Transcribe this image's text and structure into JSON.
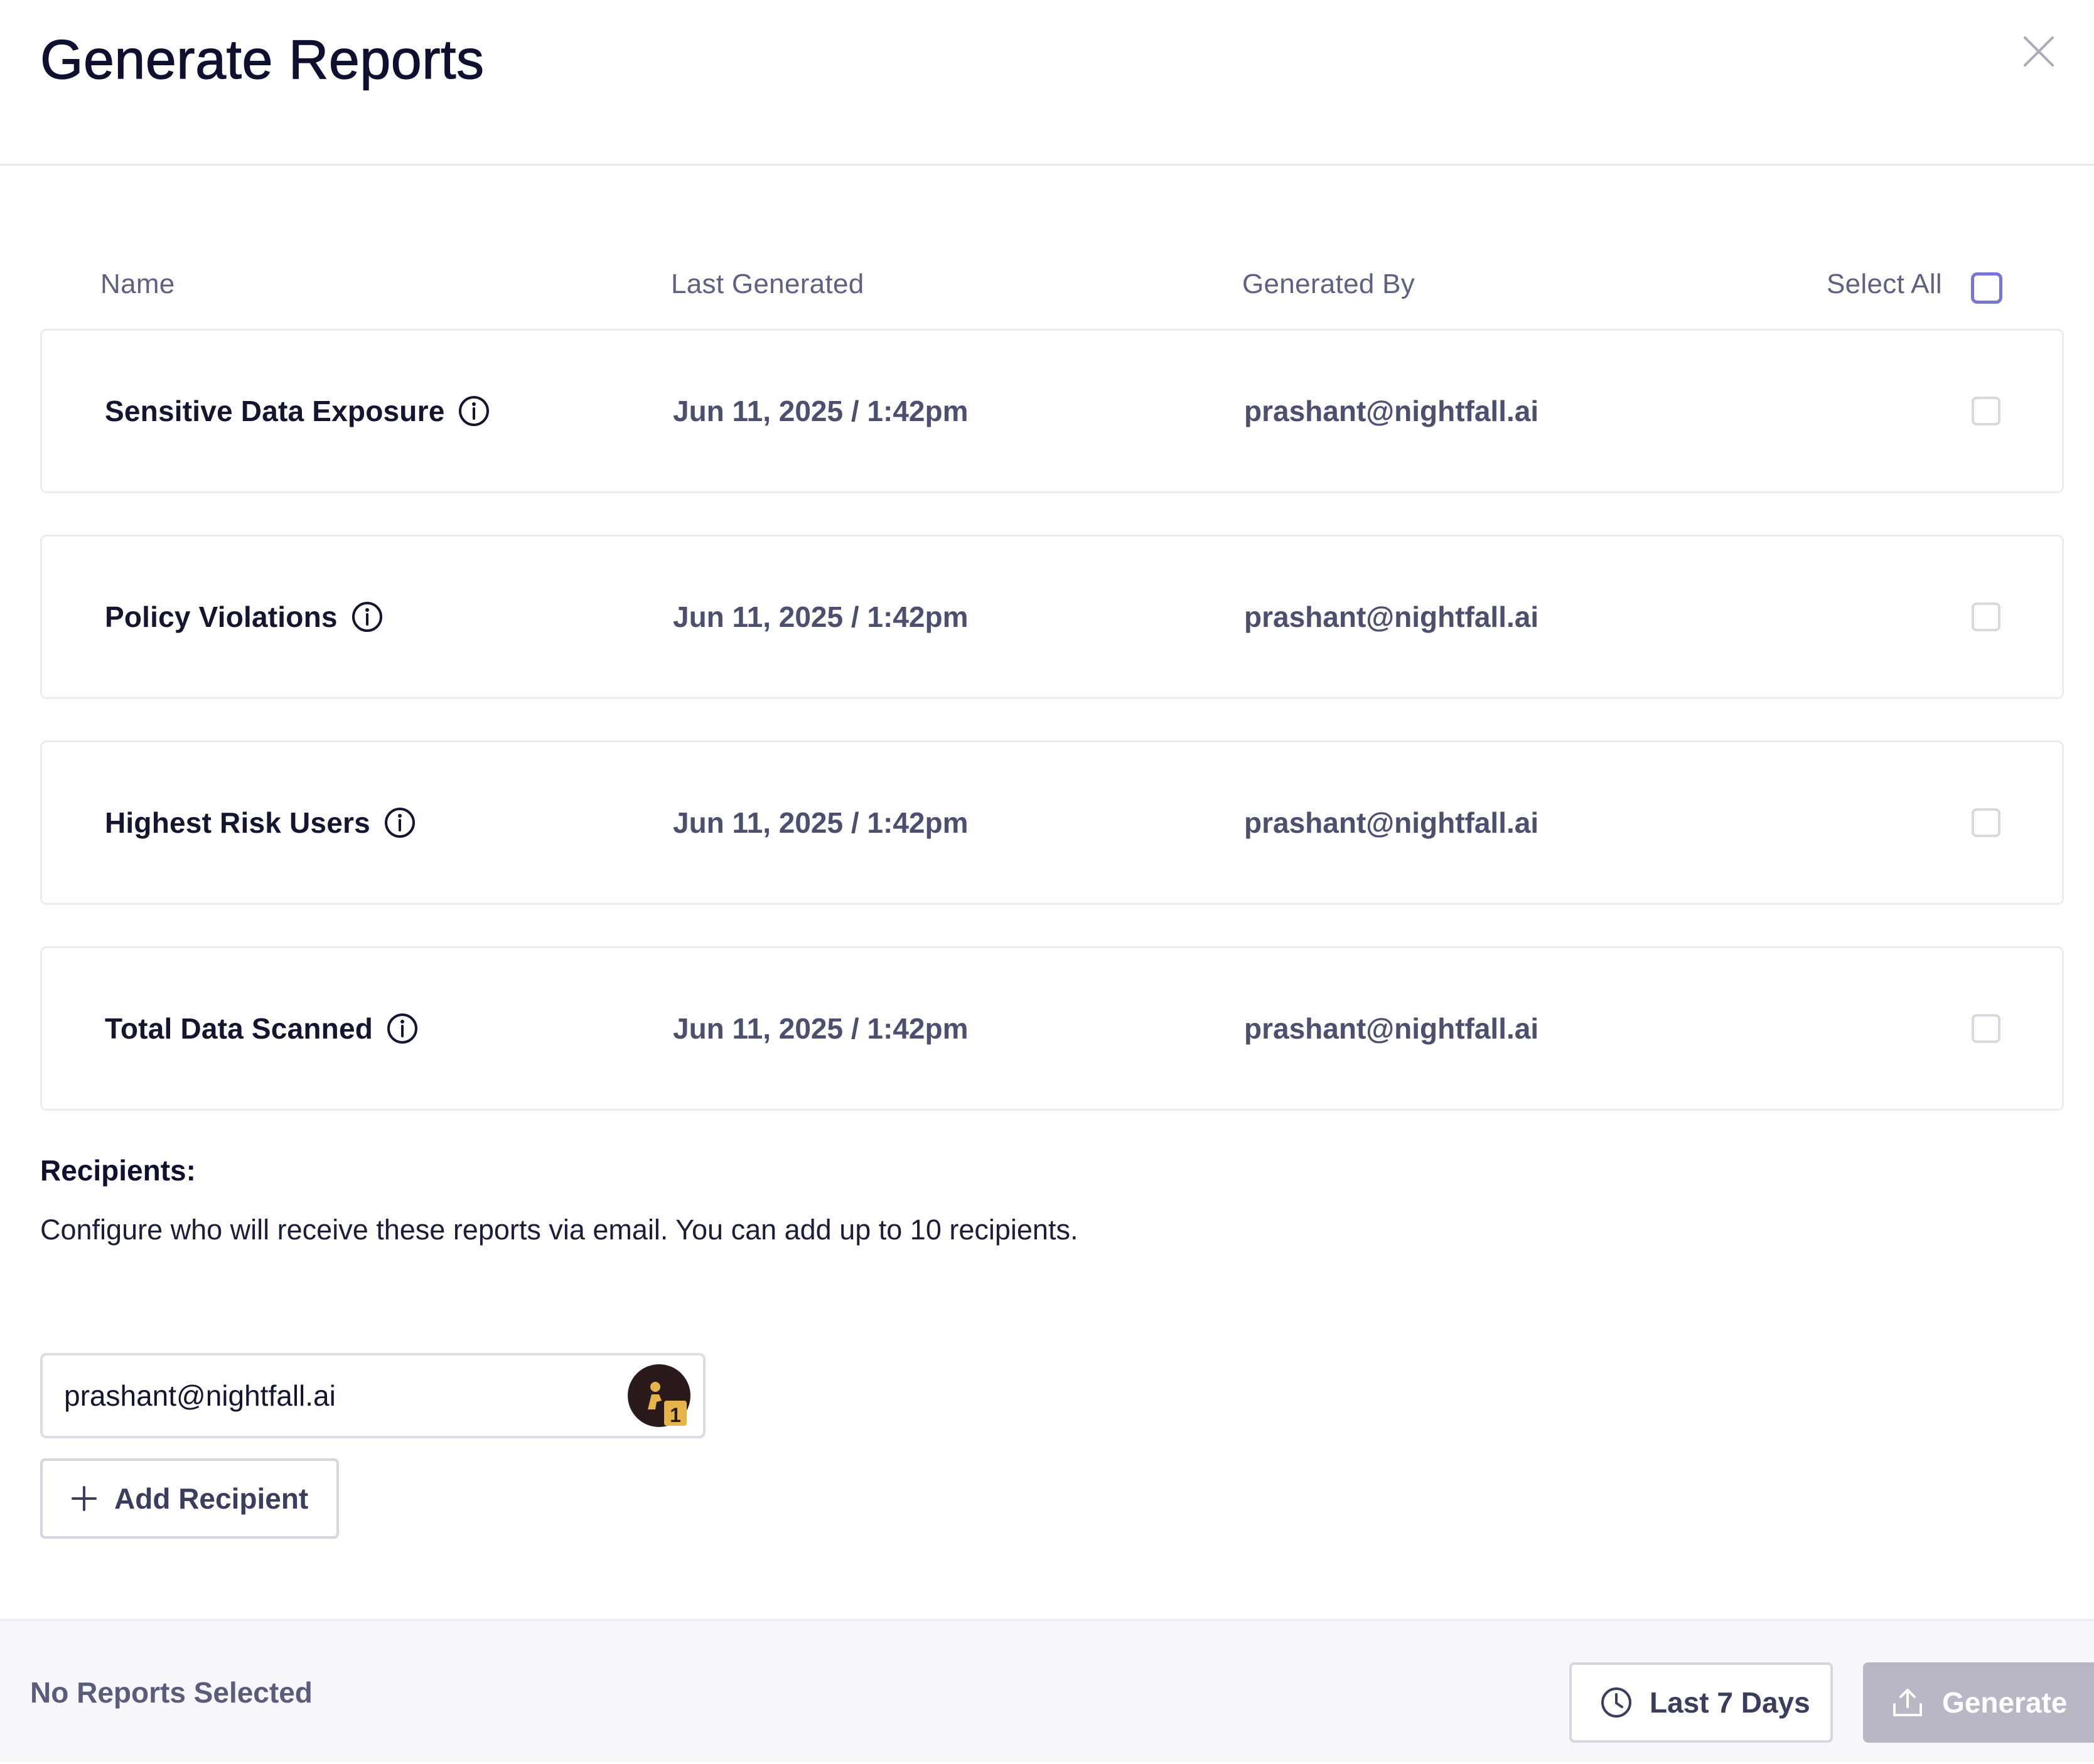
{
  "modal": {
    "title": "Generate Reports"
  },
  "table": {
    "columns": {
      "name": "Name",
      "last_generated": "Last Generated",
      "generated_by": "Generated By",
      "select_all": "Select All"
    },
    "rows": [
      {
        "name": "Sensitive Data Exposure",
        "last_generated": "Jun 11, 2025 / 1:42pm",
        "generated_by": "prashant@nightfall.ai",
        "checked": false
      },
      {
        "name": "Policy Violations",
        "last_generated": "Jun 11, 2025 / 1:42pm",
        "generated_by": "prashant@nightfall.ai",
        "checked": false
      },
      {
        "name": "Highest Risk Users",
        "last_generated": "Jun 11, 2025 / 1:42pm",
        "generated_by": "prashant@nightfall.ai",
        "checked": false
      },
      {
        "name": "Total Data Scanned",
        "last_generated": "Jun 11, 2025 / 1:42pm",
        "generated_by": "prashant@nightfall.ai",
        "checked": false
      }
    ]
  },
  "recipients": {
    "heading": "Recipients:",
    "description": "Configure who will receive these reports via email. You can add up to 10 recipients.",
    "input_value": "prashant@nightfall.ai",
    "avatar_badge": "1",
    "add_button_label": "Add Recipient"
  },
  "footer": {
    "status": "No Reports Selected",
    "range_label": "Last 7 Days",
    "generate_label": "Generate"
  },
  "icons": {
    "close": "close-icon",
    "info": "info-icon",
    "plus": "plus-icon",
    "clock": "clock-icon",
    "upload": "upload-icon"
  },
  "colors": {
    "accent_checkbox": "#7a73d8",
    "generate_disabled": "#b7b7c6",
    "text_primary": "#0f1030",
    "text_secondary": "#4d4f6e"
  }
}
